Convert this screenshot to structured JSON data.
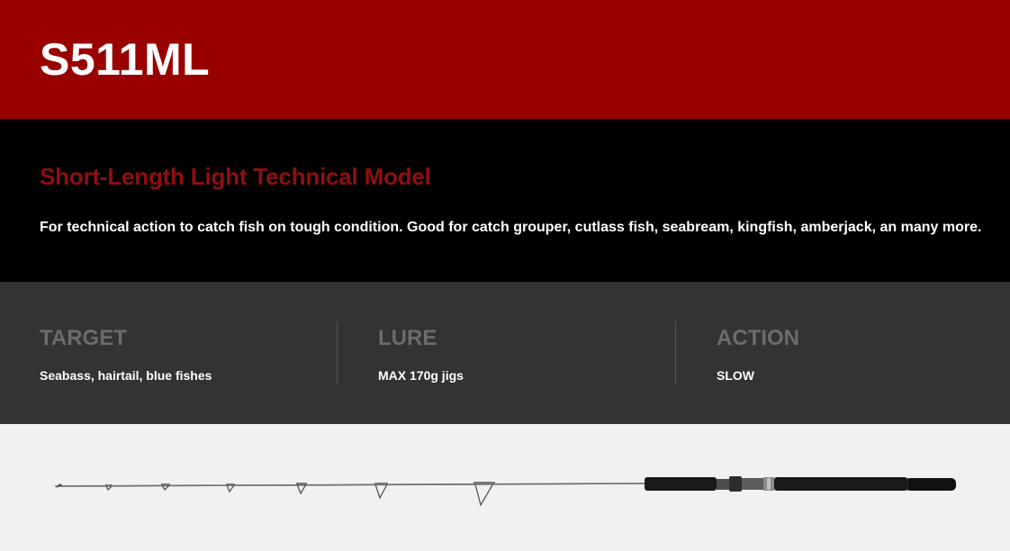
{
  "header": {
    "model": "S511ML"
  },
  "intro": {
    "subtitle": "Short-Length Light Technical Model",
    "description": "For technical action to catch fish on tough condition. Good for catch grouper, cutlass fish, seabream, kingfish, amberjack, an many more."
  },
  "specs": [
    {
      "label": "TARGET",
      "value": "Seabass, hairtail, blue fishes"
    },
    {
      "label": "LURE",
      "value": "MAX 170g jigs"
    },
    {
      "label": "ACTION",
      "value": "SLOW"
    }
  ],
  "colors": {
    "header_bg": "#990000",
    "intro_bg": "#000000",
    "subtitle": "#8f0f0f",
    "specs_bg": "#333333",
    "spec_label": "#6c6c6c",
    "product_bg": "#f1f1f1"
  },
  "product_image": {
    "icon": "fishing-rod-image"
  }
}
